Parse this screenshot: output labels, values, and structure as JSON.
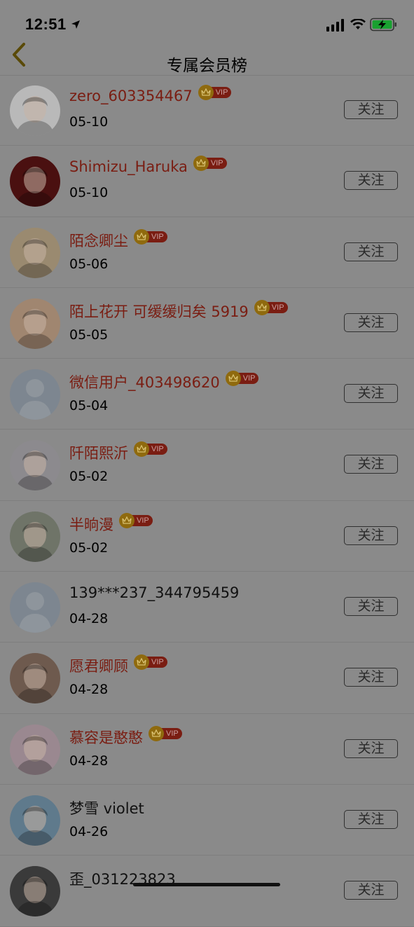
{
  "status": {
    "time": "12:51"
  },
  "nav": {
    "title": "专属会员榜"
  },
  "vip_label": "VIP",
  "follow_label": "关注",
  "members": [
    {
      "name": "zero_603354467",
      "date": "05-10",
      "vip": true,
      "avatar": "white-cat",
      "avatar_color": "#b9b9b9"
    },
    {
      "name": "Shimizu_Haruka",
      "date": "05-10",
      "vip": true,
      "avatar": "red-robed-figure",
      "avatar_color": "#4a1010"
    },
    {
      "name": "陌念卿尘",
      "date": "05-06",
      "vip": true,
      "avatar": "pomeranian-dog",
      "avatar_color": "#9a8a70"
    },
    {
      "name": "陌上花开 可缓缓归矣 5919",
      "date": "05-05",
      "vip": true,
      "avatar": "anime-girl-phone",
      "avatar_color": "#a08670"
    },
    {
      "name": "微信用户_403498620",
      "date": "05-04",
      "vip": true,
      "avatar": "default-person",
      "avatar_color": "#7d8690"
    },
    {
      "name": "阡陌熙沂",
      "date": "05-02",
      "vip": true,
      "avatar": "anime-girl-headphones",
      "avatar_color": "#8c8a8e"
    },
    {
      "name": "半晌漫",
      "date": "05-02",
      "vip": true,
      "avatar": "ink-portrait",
      "avatar_color": "#6f7468"
    },
    {
      "name": "139***237_344795459",
      "date": "04-28",
      "vip": false,
      "avatar": "default-person",
      "avatar_color": "#7d8690"
    },
    {
      "name": "愿君卿顾",
      "date": "04-28",
      "vip": true,
      "avatar": "anime-girl-brown-hair",
      "avatar_color": "#6e5a4e"
    },
    {
      "name": "慕容是憨憨",
      "date": "04-28",
      "vip": true,
      "avatar": "anime-girl-pale",
      "avatar_color": "#9a8890"
    },
    {
      "name": "梦雪 violet",
      "date": "04-26",
      "vip": false,
      "avatar": "blossom-painting",
      "avatar_color": "#5f7a8c"
    },
    {
      "name": "歪_031223823",
      "date": "",
      "vip": false,
      "avatar": "dark-photo",
      "avatar_color": "#3a3a3a"
    }
  ]
}
